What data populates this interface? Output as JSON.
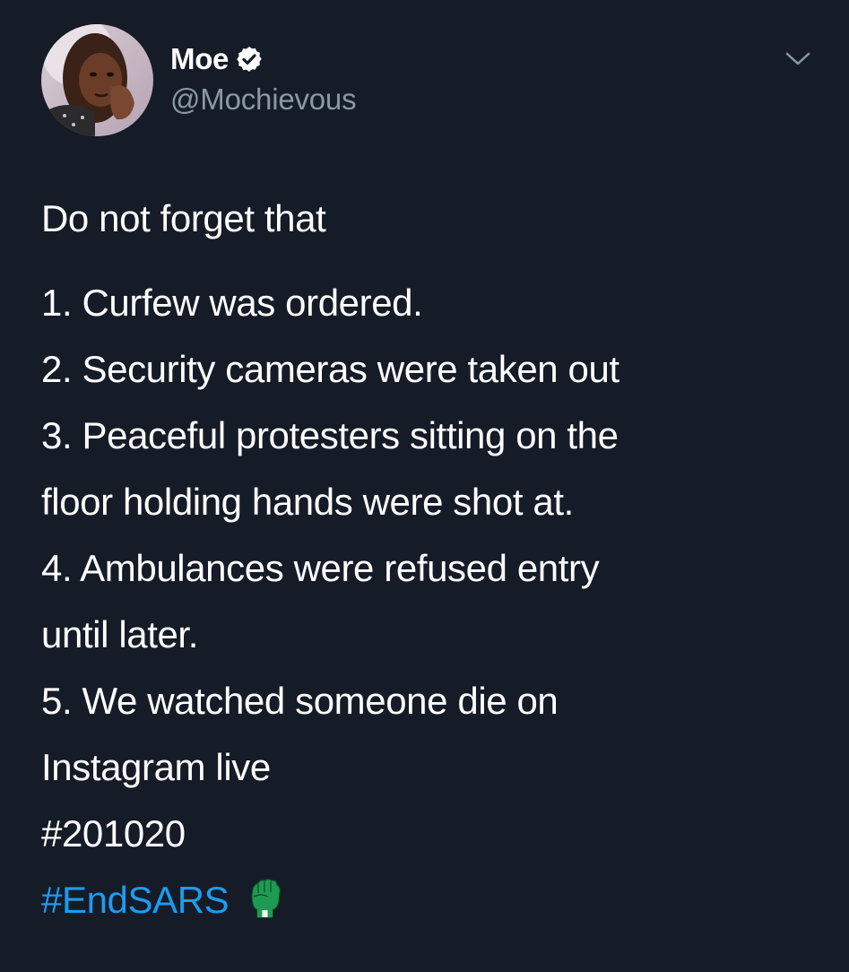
{
  "author": {
    "display_name": "Moe",
    "handle": "@Mochievous",
    "verified_icon": "verified-badge-icon",
    "avatar_icon": "profile-photo"
  },
  "menu": {
    "icon": "chevron-down-icon"
  },
  "tweet": {
    "intro": "Do not forget that",
    "lines": [
      "1. Curfew was ordered.",
      "2. Security cameras were taken out",
      "3. Peaceful protesters sitting on the",
      "floor holding hands were shot at.",
      "4. Ambulances were refused entry",
      "until later.",
      "5. We watched someone die on",
      "Instagram live"
    ],
    "hashtags": [
      "#201020",
      "#EndSARS"
    ],
    "hashtag_emoji": "green-raised-fist-icon"
  },
  "colors": {
    "background": "#151c27",
    "text": "#ffffff",
    "muted": "#8a98a5",
    "link": "#1d9bf0",
    "fist_green": "#1f9a52"
  }
}
